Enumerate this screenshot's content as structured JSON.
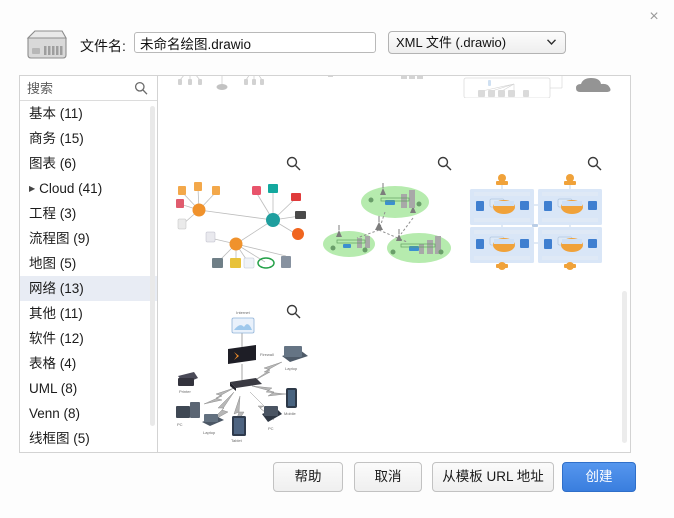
{
  "dialog": {
    "close_label": "×",
    "drive_icon": "hard-drive-icon"
  },
  "header": {
    "filename_label": "文件名:",
    "filename_value": "未命名绘图.drawio",
    "filename_placeholder": "文件名",
    "filetype_selected": "XML 文件 (.drawio)",
    "filetype_options": [
      "XML 文件 (.drawio)"
    ],
    "chevron": "⌄"
  },
  "sidebar": {
    "search_placeholder": "搜索",
    "search_value": "",
    "search_icon": "search-icon",
    "items": [
      {
        "label": "基本 (11)",
        "name": "basic",
        "expandable": false,
        "selected": false
      },
      {
        "label": "商务 (15)",
        "name": "business",
        "expandable": false,
        "selected": false
      },
      {
        "label": "图表 (6)",
        "name": "charts",
        "expandable": false,
        "selected": false
      },
      {
        "label": "Cloud (41)",
        "name": "cloud",
        "expandable": true,
        "selected": false
      },
      {
        "label": "工程 (3)",
        "name": "engineering",
        "expandable": false,
        "selected": false
      },
      {
        "label": "流程图 (9)",
        "name": "flowchart",
        "expandable": false,
        "selected": false
      },
      {
        "label": "地图 (5)",
        "name": "maps",
        "expandable": false,
        "selected": false
      },
      {
        "label": "网络 (13)",
        "name": "network",
        "expandable": false,
        "selected": true
      },
      {
        "label": "其他 (11)",
        "name": "other",
        "expandable": false,
        "selected": false
      },
      {
        "label": "软件 (12)",
        "name": "software",
        "expandable": false,
        "selected": false
      },
      {
        "label": "表格 (4)",
        "name": "tables",
        "expandable": false,
        "selected": false
      },
      {
        "label": "UML (8)",
        "name": "uml",
        "expandable": false,
        "selected": false
      },
      {
        "label": "Venn (8)",
        "name": "venn",
        "expandable": false,
        "selected": false
      },
      {
        "label": "线框图 (5)",
        "name": "wireframe",
        "expandable": false,
        "selected": false
      }
    ],
    "expand_triangle": "▶"
  },
  "preview": {
    "zoom_icon": "magnifier-icon",
    "templates": [
      {
        "name": "template-top-left-partial",
        "kind": "network-tree-partial"
      },
      {
        "name": "template-top-mid-partial",
        "kind": "org-tree-partial"
      },
      {
        "name": "template-top-right-partial",
        "kind": "rack-switch-partial"
      },
      {
        "name": "template-top-cloud-partial",
        "kind": "cloud-partial"
      },
      {
        "name": "template-active-directory",
        "kind": "hub-and-spoke"
      },
      {
        "name": "template-wireless-coverage",
        "kind": "green-cells"
      },
      {
        "name": "template-datacenter-grid",
        "kind": "blue-racks"
      },
      {
        "name": "template-home-network",
        "kind": "wifi-star",
        "node_labels": [
          "Internet",
          "Firewall",
          "Printer",
          "PC",
          "Laptop",
          "Tablet",
          "PC",
          "Mobile",
          "Laptop"
        ]
      }
    ]
  },
  "footer": {
    "help_label": "帮助",
    "cancel_label": "取消",
    "url_label": "从模板 URL 地址",
    "create_label": "创建"
  },
  "colors": {
    "accent": "#4285e8",
    "selected_row": "#e8ecf4",
    "border": "#d3d3d3",
    "text": "#1a1a1a",
    "muted": "#5c5c5c"
  }
}
